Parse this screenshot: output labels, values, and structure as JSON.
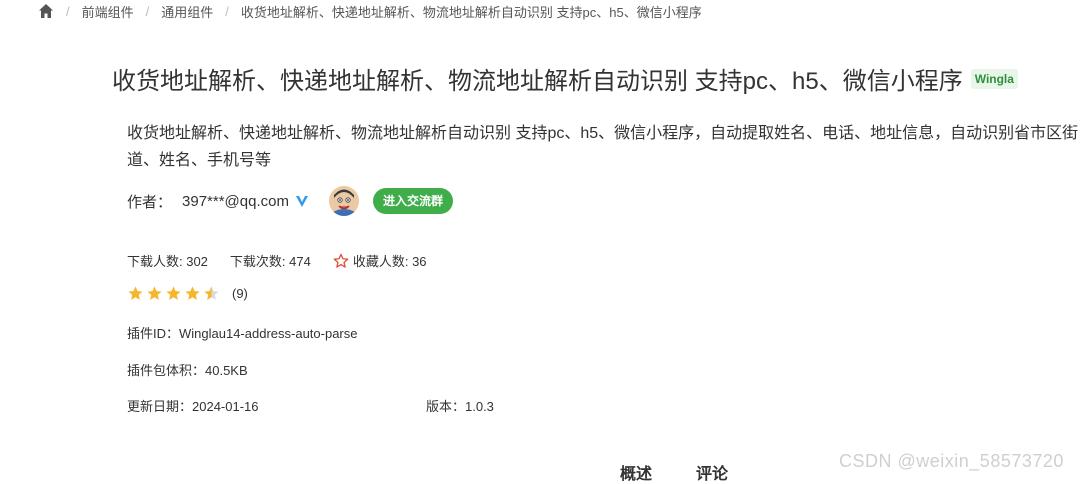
{
  "breadcrumb": {
    "items": [
      "前端组件",
      "通用组件",
      "收货地址解析、快递地址解析、物流地址解析自动识别 支持pc、h5、微信小程序"
    ]
  },
  "plugin": {
    "title": "收货地址解析、快递地址解析、物流地址解析自动识别 支持pc、h5、微信小程序",
    "badge": "Wingla",
    "description": "收货地址解析、快递地址解析、物流地址解析自动识别 支持pc、h5、微信小程序，自动提取姓名、电话、地址信息，自动识别省市区街道、姓名、手机号等",
    "author_label": "作者：",
    "author": "397***@qq.com",
    "group_button": "进入交流群"
  },
  "stats": {
    "users": "下载人数: 302",
    "downloads": "下载次数: 474",
    "favorites": "收藏人数: 36"
  },
  "rating": {
    "stars": 4.5,
    "count": "(9)"
  },
  "info": {
    "plugin_id": "插件ID：Winglau14-address-auto-parse",
    "size": "插件包体积：40.5KB",
    "update_date": "更新日期：2024-01-16",
    "version": "版本：1.0.3"
  },
  "tabs": [
    "概述",
    "评论"
  ],
  "watermark": "CSDN @weixin_58573720",
  "colors": {
    "accent_green": "#3fae4a",
    "star_yellow": "#f7b52c",
    "verify_blue": "#2e9bf0"
  }
}
